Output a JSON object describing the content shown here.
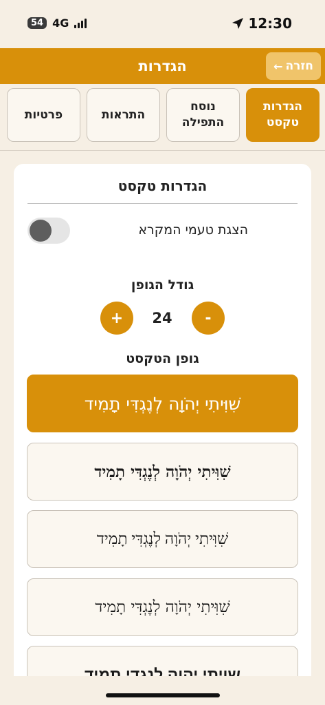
{
  "status_bar": {
    "battery": "54",
    "network": "4G",
    "time": "12:30",
    "icons": [
      "signal-bars-icon",
      "location-arrow-icon"
    ]
  },
  "header": {
    "title": "הגדרות",
    "back_label": "חזרה",
    "back_icon": "arrow-left-icon"
  },
  "tabs": [
    {
      "label": "הגדרות טקסט",
      "active": true
    },
    {
      "label": "נוסח התפילה",
      "active": false
    },
    {
      "label": "התראות",
      "active": false
    },
    {
      "label": "פרטיות",
      "active": false
    }
  ],
  "text_settings": {
    "title": "הגדרות טקסט",
    "cantillation_label": "הצגת טעמי המקרא",
    "cantillation_enabled": false,
    "font_size_label": "גודל הגופן",
    "font_size_value": "24",
    "plus_label": "+",
    "minus_label": "-",
    "font_family_label": "גופן הטקסט",
    "font_options": [
      {
        "sample": "שִׁוִּיתִי יְהֹוָה לְנֶגְדִּי תָמִיד",
        "selected": true
      },
      {
        "sample": "שִׁוִּיתִי יְהֹוָה לְנֶגְדִּי תָמִיד",
        "selected": false
      },
      {
        "sample": "שִׁוִּיתִי יְהֹוָה לְנֶגְדִּי תָמִיד",
        "selected": false
      },
      {
        "sample": "שִׁוִּיתִי יְהֹוָה לְנֶגְדִּי תָמִיד",
        "selected": false
      },
      {
        "sample": "שויתי יהוה לנגדי תמיד",
        "selected": false
      }
    ]
  },
  "colors": {
    "accent": "#d8900a",
    "background": "#f6efe4",
    "card": "#ffffff"
  }
}
